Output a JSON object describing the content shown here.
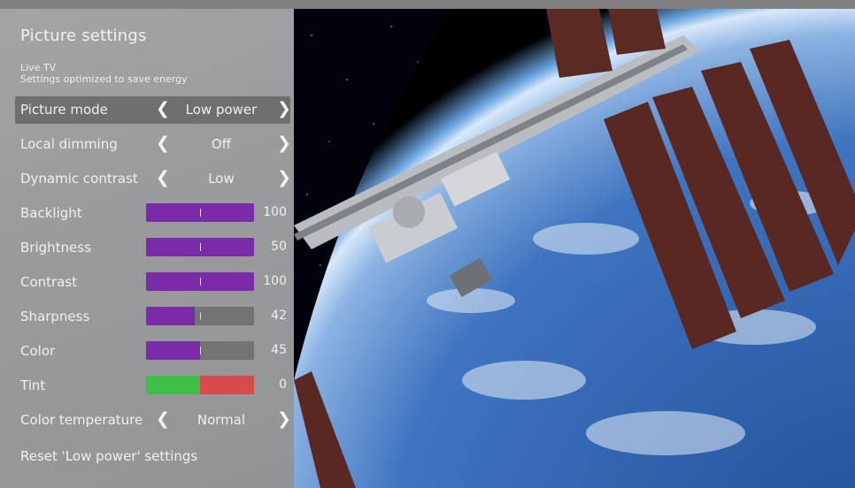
{
  "panel": {
    "title": "Picture settings",
    "source": "Live TV",
    "subtitle": "Settings optimized to save energy"
  },
  "options": [
    {
      "label": "Picture mode",
      "value": "Low power",
      "left_icon": "chevron-left-icon",
      "right_icon": "chevron-right-icon"
    },
    {
      "label": "Local dimming",
      "value": "Off",
      "left_icon": "chevron-left-icon",
      "right_icon": "chevron-right-icon"
    },
    {
      "label": "Dynamic contrast",
      "value": "Low",
      "left_icon": "chevron-left-icon",
      "right_icon": "chevron-right-icon"
    }
  ],
  "sliders": [
    {
      "label": "Backlight",
      "value": "100",
      "fill_fraction": 1.0
    },
    {
      "label": "Brightness",
      "value": "50",
      "fill_fraction": 1.0
    },
    {
      "label": "Contrast",
      "value": "100",
      "fill_fraction": 1.0
    },
    {
      "label": "Sharpness",
      "value": "42",
      "fill_fraction": 0.45
    },
    {
      "label": "Color",
      "value": "45",
      "fill_fraction": 0.5
    }
  ],
  "tint": {
    "label": "Tint",
    "value": "0"
  },
  "color_temperature": {
    "label": "Color temperature",
    "value": "Normal"
  },
  "reset": {
    "label": "Reset 'Low power' settings"
  },
  "colors": {
    "slider_fill": "#7b2aa8",
    "slider_track": "#737373",
    "tint_green": "#3fbf46",
    "tint_red": "#d94a4a",
    "selected_row": "#6f6f70"
  }
}
